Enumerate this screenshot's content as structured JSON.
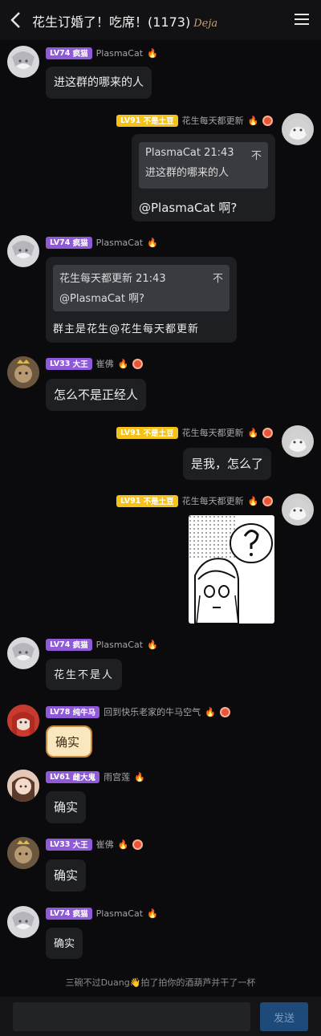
{
  "header": {
    "title": "花生订婚了！吃席！(1173)",
    "badge_text": "Deja"
  },
  "messages": [
    {
      "sender": "PlasmaCat",
      "level": "LV74",
      "title": "疯猫",
      "text": "进这群的哪来的人"
    },
    {
      "sender": "花生每天都更新",
      "level": "LV91",
      "title": "不是土豆",
      "quote_header": "PlasmaCat 21:43",
      "quote_text": "进这群的哪来的人",
      "text": "@PlasmaCat 啊?"
    },
    {
      "sender": "PlasmaCat",
      "level": "LV74",
      "title": "疯猫",
      "quote_header": "花生每天都更新 21:43",
      "quote_text": "@PlasmaCat 啊?",
      "text": "群主是花生@花生每天都更新"
    },
    {
      "sender": "崔佛",
      "level": "LV33",
      "title": "大王",
      "text": "怎么不是正经人"
    },
    {
      "sender": "花生每天都更新",
      "level": "LV91",
      "title": "不是土豆",
      "text": "是我，怎么了"
    },
    {
      "sender": "花生每天都更新",
      "level": "LV91",
      "title": "不是土豆",
      "image": "question-girl-sticker"
    },
    {
      "sender": "PlasmaCat",
      "level": "LV74",
      "title": "疯猫",
      "text": "花生不是人"
    },
    {
      "sender": "回到快乐老家的牛马空气",
      "level": "LV78",
      "title": "纯牛马",
      "text": "确实"
    },
    {
      "sender": "雨宫莲",
      "level": "LV61",
      "title": "雌大鬼",
      "text": "确实"
    },
    {
      "sender": "崔佛",
      "level": "LV33",
      "title": "大王",
      "text": "确实"
    },
    {
      "sender": "PlasmaCat",
      "level": "LV74",
      "title": "疯猫",
      "text": "确实"
    }
  ],
  "quote_close": "不",
  "system_message": "三碗不过Duang👋拍了拍你的酒葫芦并干了一杯",
  "composer": {
    "placeholder": "",
    "send_label": "发送"
  },
  "colors": {
    "accent_purple": "#8e5ad8",
    "accent_yellow": "#f4c21a",
    "send_bg": "#1d4a78",
    "background": "#0b0b0d"
  }
}
